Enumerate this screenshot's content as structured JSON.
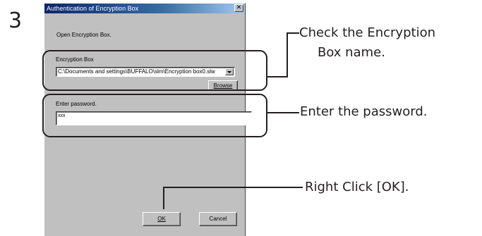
{
  "step": {
    "number": "3"
  },
  "dialog": {
    "title": "Authentication of Encryption Box",
    "close_glyph": "✕",
    "intro_text": "Open Encryption Box.",
    "box_label": "Encryption Box",
    "box_path_value": "C:\\Documents and settings\\BUFFALO\\slm\\Encryption box0.slw",
    "browse_label": "Browse",
    "password_label": "Enter password.",
    "password_value": "xxx",
    "ok_label": "OK",
    "cancel_label": "Cancel"
  },
  "callouts": {
    "box_name_line1": "Check the Encryption",
    "box_name_line2": "Box name.",
    "password": "Enter the password.",
    "ok": "Right Click [OK]."
  }
}
